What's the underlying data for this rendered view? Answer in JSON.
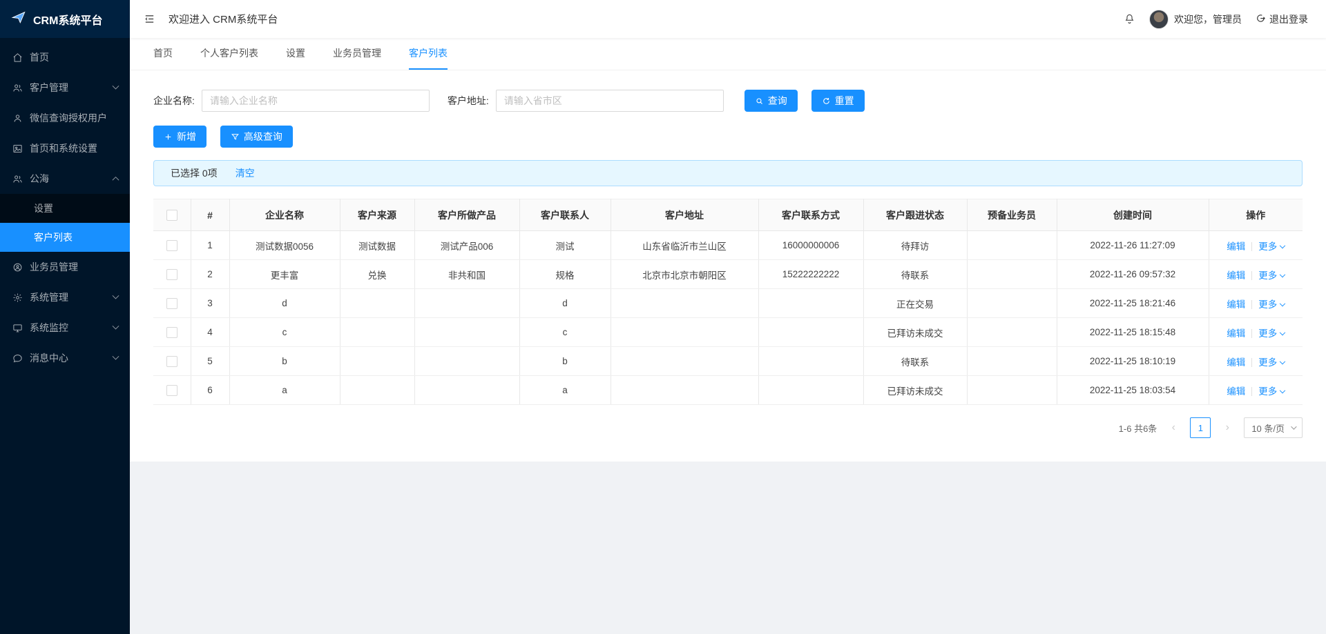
{
  "app": {
    "title": "CRM系统平台"
  },
  "colors": {
    "accent": "#1890ff",
    "sidebar_bg": "#001529",
    "selection_bg": "#e6f7ff"
  },
  "topbar": {
    "welcome": "欢迎进入 CRM系统平台",
    "greeting": "欢迎您，管理员",
    "logout_label": "退出登录"
  },
  "sidebar": {
    "items": [
      {
        "label": "首页",
        "icon": "home-icon"
      },
      {
        "label": "客户管理",
        "icon": "users-icon",
        "chevron": "down"
      },
      {
        "label": "微信查询授权用户",
        "icon": "user-icon"
      },
      {
        "label": "首页和系统设置",
        "icon": "image-icon"
      },
      {
        "label": "公海",
        "icon": "team-icon",
        "chevron": "up",
        "children": [
          {
            "label": "设置",
            "active": false
          },
          {
            "label": "客户列表",
            "active": true
          }
        ]
      },
      {
        "label": "业务员管理",
        "icon": "badge-icon"
      },
      {
        "label": "系统管理",
        "icon": "gear-icon",
        "chevron": "down"
      },
      {
        "label": "系统监控",
        "icon": "monitor-icon",
        "chevron": "down"
      },
      {
        "label": "消息中心",
        "icon": "message-icon",
        "chevron": "down"
      }
    ]
  },
  "tabs": [
    {
      "label": "首页",
      "active": false
    },
    {
      "label": "个人客户列表",
      "active": false
    },
    {
      "label": "设置",
      "active": false
    },
    {
      "label": "业务员管理",
      "active": false
    },
    {
      "label": "客户列表",
      "active": true
    }
  ],
  "filters": {
    "company_label": "企业名称:",
    "company_placeholder": "请输入企业名称",
    "address_label": "客户地址:",
    "address_placeholder": "请输入省市区",
    "search_button": "查询",
    "reset_button": "重置"
  },
  "actions": {
    "add_button": "新增",
    "advanced_button": "高级查询"
  },
  "selection_bar": {
    "text": "已选择 0项",
    "clear_link": "清空"
  },
  "table": {
    "columns": [
      "#",
      "企业名称",
      "客户来源",
      "客户所做产品",
      "客户联系人",
      "客户地址",
      "客户联系方式",
      "客户跟进状态",
      "预备业务员",
      "创建时间",
      "操作"
    ],
    "edit_label": "编辑",
    "more_label": "更多",
    "rows": [
      {
        "index": "1",
        "company": "测试数据0056",
        "source": "测试数据",
        "product": "测试产品006",
        "contact": "测试",
        "address": "山东省临沂市兰山区",
        "phone": "16000000006",
        "status": "待拜访",
        "salesperson": "",
        "created": "2022-11-26 11:27:09"
      },
      {
        "index": "2",
        "company": "更丰富",
        "source": "兑换",
        "product": "非共和国",
        "contact": "规格",
        "address": "北京市北京市朝阳区",
        "phone": "15222222222",
        "status": "待联系",
        "salesperson": "",
        "created": "2022-11-26 09:57:32"
      },
      {
        "index": "3",
        "company": "d",
        "source": "",
        "product": "",
        "contact": "d",
        "address": "",
        "phone": "",
        "status": "正在交易",
        "salesperson": "",
        "created": "2022-11-25 18:21:46"
      },
      {
        "index": "4",
        "company": "c",
        "source": "",
        "product": "",
        "contact": "c",
        "address": "",
        "phone": "",
        "status": "已拜访未成交",
        "salesperson": "",
        "created": "2022-11-25 18:15:48"
      },
      {
        "index": "5",
        "company": "b",
        "source": "",
        "product": "",
        "contact": "b",
        "address": "",
        "phone": "",
        "status": "待联系",
        "salesperson": "",
        "created": "2022-11-25 18:10:19"
      },
      {
        "index": "6",
        "company": "a",
        "source": "",
        "product": "",
        "contact": "a",
        "address": "",
        "phone": "",
        "status": "已拜访未成交",
        "salesperson": "",
        "created": "2022-11-25 18:03:54"
      }
    ]
  },
  "pagination": {
    "total_text": "1-6 共6条",
    "current_page": "1",
    "page_size": "10 条/页"
  }
}
